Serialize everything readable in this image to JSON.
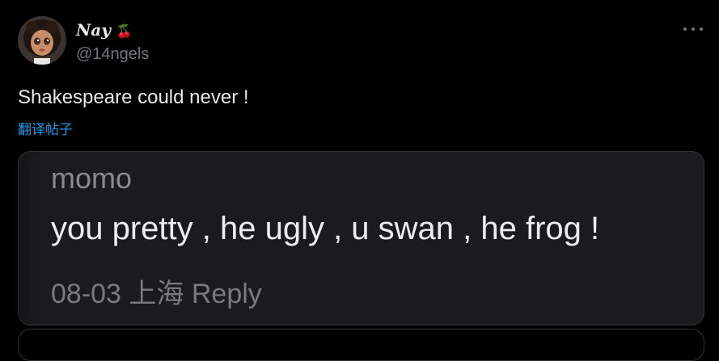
{
  "author": {
    "display_name": "Nay",
    "display_emoji": "🍒",
    "handle": "@14ngels",
    "avatar_icon": "profile-avatar"
  },
  "tweet": {
    "text": "Shakespeare could never !",
    "translate_label": "翻译帖子"
  },
  "media": {
    "comment_username": "momo",
    "comment_text": "you pretty , he ugly , u swan , he frog !",
    "comment_date": "08-03",
    "comment_location": "上海",
    "comment_reply_label": "Reply"
  },
  "colors": {
    "background": "#000000",
    "text_primary": "#e7e9ea",
    "text_secondary": "#71767b",
    "link": "#1d9bf0",
    "card_border": "#2f3336",
    "card_background": "#1b1b1d"
  }
}
